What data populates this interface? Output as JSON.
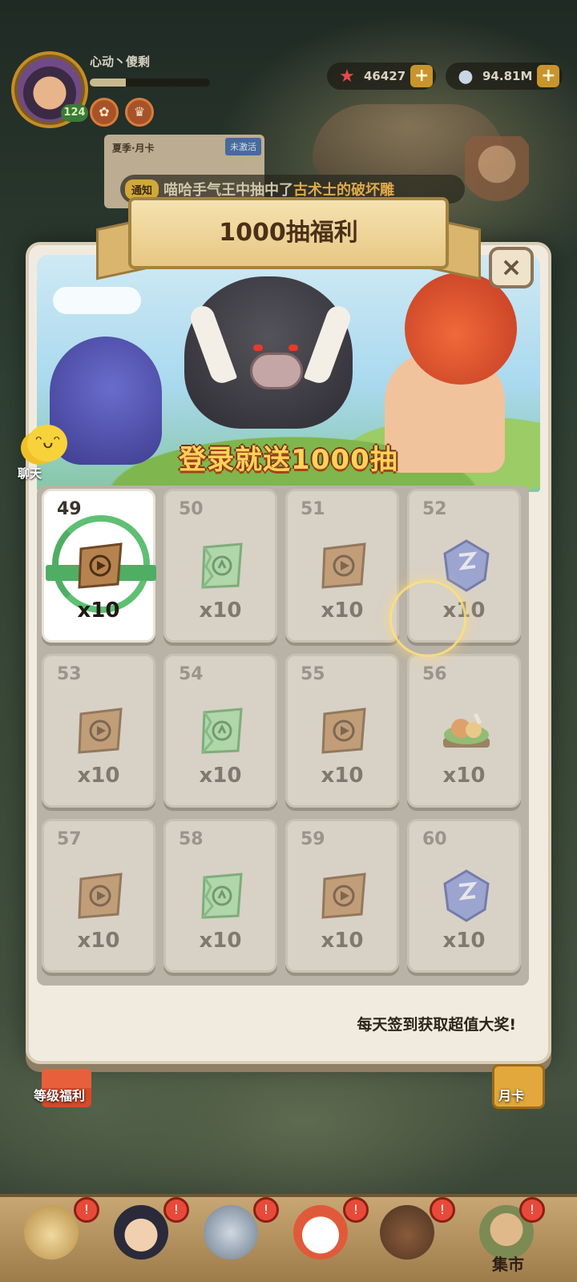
{
  "player": {
    "name": "心动丶傻剩",
    "level": "124",
    "xp_fraction": 0.3
  },
  "currencies": [
    {
      "icon": "starfish-icon",
      "value": "46427",
      "color": "#e24a4a"
    },
    {
      "icon": "stone-icon",
      "value": "94.81M",
      "color": "#c9d6e3"
    }
  ],
  "season_card": {
    "title": "夏季·月卡",
    "status": "未激活"
  },
  "notice": {
    "tag": "通知",
    "message_prefix": "喵哈手气王中抽中了",
    "message_highlight": "古术士的破坏雕"
  },
  "dialog": {
    "title": "1000抽福利",
    "banner_caption": "登录就送1000抽",
    "footer": "每天签到获取超值大奖!",
    "close_symbol": "×"
  },
  "chat": {
    "label": "聊天"
  },
  "rewards": [
    {
      "day": "49",
      "item": "draw-ticket-icon",
      "qty": "x10",
      "state": "claimed"
    },
    {
      "day": "50",
      "item": "green-ticket-icon",
      "qty": "x10",
      "state": "locked"
    },
    {
      "day": "51",
      "item": "draw-ticket-icon",
      "qty": "x10",
      "state": "locked"
    },
    {
      "day": "52",
      "item": "crystal-icon",
      "qty": "x10",
      "state": "locked"
    },
    {
      "day": "53",
      "item": "draw-ticket-icon",
      "qty": "x10",
      "state": "locked"
    },
    {
      "day": "54",
      "item": "green-ticket-icon",
      "qty": "x10",
      "state": "locked"
    },
    {
      "day": "55",
      "item": "draw-ticket-icon",
      "qty": "x10",
      "state": "locked"
    },
    {
      "day": "56",
      "item": "food-platter-icon",
      "qty": "x10",
      "state": "locked"
    },
    {
      "day": "57",
      "item": "draw-ticket-icon",
      "qty": "x10",
      "state": "locked"
    },
    {
      "day": "58",
      "item": "green-ticket-icon",
      "qty": "x10",
      "state": "locked"
    },
    {
      "day": "59",
      "item": "draw-ticket-icon",
      "qty": "x10",
      "state": "locked"
    },
    {
      "day": "60",
      "item": "crystal-icon",
      "qty": "x10",
      "state": "locked"
    }
  ],
  "side": {
    "level_welfare": "等级福利",
    "month_card": "月卡"
  },
  "bottom_nav": {
    "market_label": "集市",
    "badge": "!"
  }
}
